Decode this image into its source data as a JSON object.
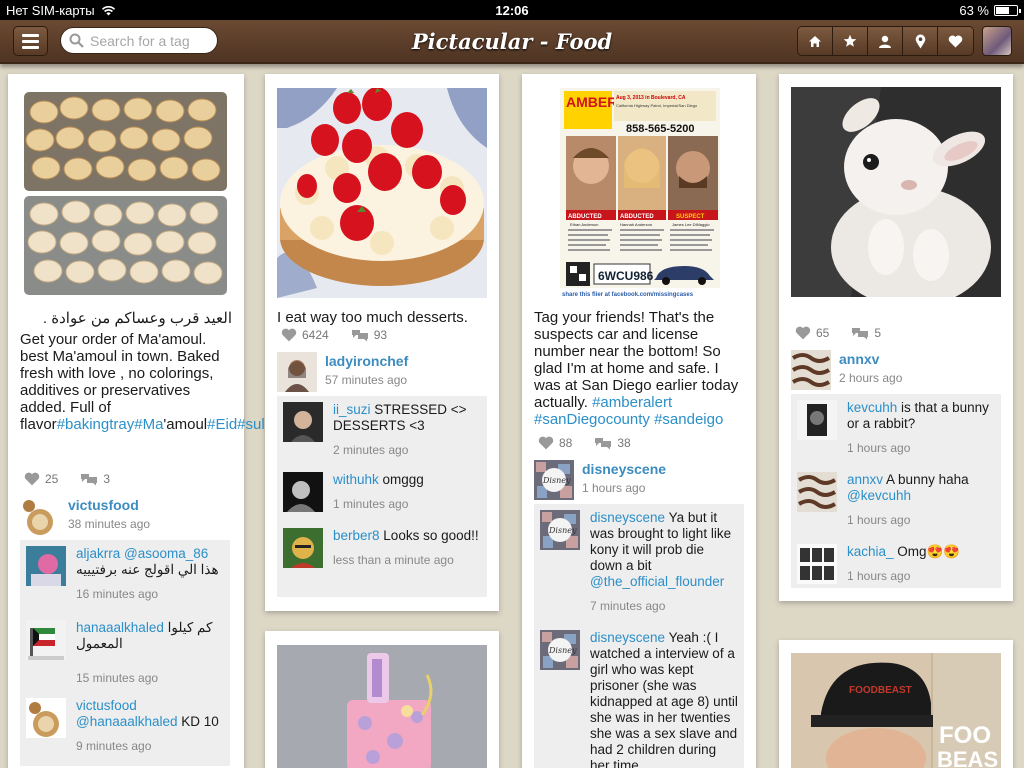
{
  "status": {
    "carrier": "Нет SIM-карты",
    "time": "12:06",
    "battery": "63 %",
    "battery_level": 0.63
  },
  "header": {
    "title": "Pictacular - Food",
    "search_placeholder": "Search for a tag",
    "nav": [
      "home-icon",
      "star-icon",
      "person-icon",
      "location-pin-icon",
      "heart-icon"
    ]
  },
  "posts": [
    {
      "caption_ar": "العيد قرب وعساكم من عوادة .",
      "caption_parts": [
        "Get your order of Ma'amoul. best Ma'amoul in town. Baked fresh with love , no colorings, additives or preservatives added. Full of flavor",
        "#bakingtray#Ma",
        "'amoul",
        "#Eid#sultancenter"
      ],
      "likes": "25",
      "comments_count": "3",
      "user": "victusfood",
      "time": "38 minutes ago",
      "comments": [
        {
          "user": "aljakrra",
          "text": "@asooma_86",
          "text2": "هذا الي اقولج عنه برفتيييه",
          "time": "16 minutes ago"
        },
        {
          "user": "hanaaalkhaled",
          "text": "كم كيلوا المعمول",
          "time": "15 minutes ago"
        },
        {
          "user": "victusfood",
          "mention": "@hanaaalkhaled",
          "text": " KD 10",
          "time": "9 minutes ago"
        }
      ]
    },
    {
      "caption": "I eat way too much desserts.",
      "likes": "6424",
      "comments_count": "93",
      "user": "ladyironchef",
      "time": "57 minutes ago",
      "comments": [
        {
          "user": "ii_suzi",
          "text": " STRESSED <> DESSERTS <3",
          "time": "2 minutes ago"
        },
        {
          "user": "withuhk",
          "text": " omggg",
          "time": "1 minutes ago"
        },
        {
          "user": "berber8",
          "text": " Looks so good!!",
          "time": "less than a minute ago"
        }
      ]
    },
    {
      "caption": "Tag your friends! That's the suspects car and license number near the bottom! So glad I'm at home and safe. I was at San Diego earlier today actually. ",
      "caption_tags": "#amberalert #sanDiegocounty #sandeigo",
      "likes": "88",
      "comments_count": "38",
      "user": "disneyscene",
      "time": "1 hours ago",
      "comments": [
        {
          "user": "disneyscene",
          "text": " Ya but it was brought to light like kony it will prob die down a bit ",
          "mention": "@the_official_flounder",
          "time": "7 minutes ago"
        },
        {
          "user": "disneyscene",
          "text": " Yeah :( I watched a interview of a girl who was kept prisoner (she was kidnapped at age 8) until she was in her twenties she was a sex slave and had 2 children during her time"
        }
      ],
      "flyer": {
        "headline": "AMBER ALERT",
        "info": "Aug 3, 2013 in Boulevard, CA",
        "sub": "California Highway Patrol, Imperial/San Diego",
        "phone": "858-565-5200",
        "labels": [
          "ABDUCTED",
          "ABDUCTED",
          "SUSPECT"
        ],
        "names": [
          "Ethan Anderson",
          "Hannah Anderson",
          "James Lee DiMaggio"
        ],
        "plate": "6WCU986",
        "footer": "share this flier at facebook.com/missingcases"
      }
    },
    {
      "likes": "65",
      "comments_count": "5",
      "user": "annxv",
      "time": "2 hours ago",
      "comments": [
        {
          "user": "kevcuhh",
          "text": " is that a bunny or a rabbit?",
          "time": "1 hours ago"
        },
        {
          "user": "annxv",
          "text": " A bunny haha ",
          "mention": "@kevcuhh",
          "time": "1 hours ago"
        },
        {
          "user": "kachia_",
          "text": " Omg😍😍",
          "time": "1 hours ago"
        }
      ]
    },
    {
      "image": "cake-photo"
    },
    {
      "image": "foodbeast-photo",
      "text1": "FOODBEAST",
      "text2": "FOO",
      "text3": "BEAS"
    }
  ]
}
